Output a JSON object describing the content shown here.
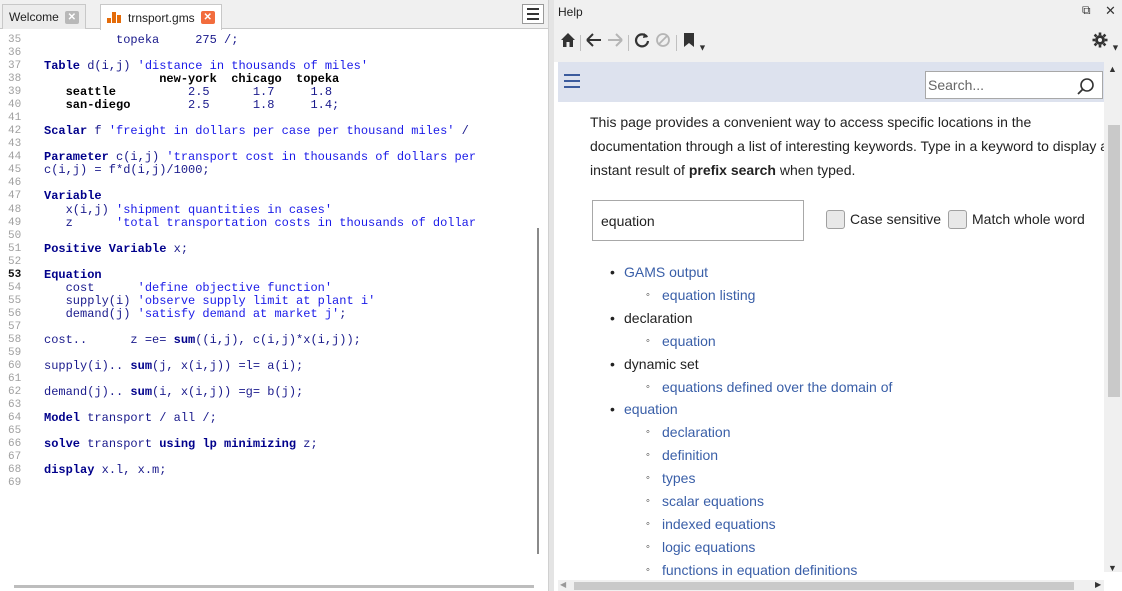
{
  "editor": {
    "tabs": [
      {
        "label": "Welcome",
        "active": false
      },
      {
        "label": "trnsport.gms",
        "active": true
      }
    ],
    "current_line": "53",
    "lines": [
      {
        "n": "35",
        "segs": [
          {
            "t": "nm",
            "v": "          topeka     275 /;"
          }
        ]
      },
      {
        "n": "36",
        "segs": []
      },
      {
        "n": "37",
        "segs": [
          {
            "t": "kw",
            "v": "Table"
          },
          {
            "t": "nm",
            "v": " d(i,j) "
          },
          {
            "t": "st",
            "v": "'distance in thousands of miles'"
          }
        ]
      },
      {
        "n": "38",
        "segs": [
          {
            "t": "bl",
            "v": "                new-york  chicago  topeka"
          }
        ]
      },
      {
        "n": "39",
        "segs": [
          {
            "t": "bl",
            "v": "   seattle"
          },
          {
            "t": "nm",
            "v": "          2.5      1.7     1.8"
          }
        ]
      },
      {
        "n": "40",
        "segs": [
          {
            "t": "bl",
            "v": "   san-diego"
          },
          {
            "t": "nm",
            "v": "        2.5      1.8     1.4;"
          }
        ]
      },
      {
        "n": "41",
        "segs": []
      },
      {
        "n": "42",
        "segs": [
          {
            "t": "kw",
            "v": "Scalar"
          },
          {
            "t": "nm",
            "v": " f "
          },
          {
            "t": "st",
            "v": "'freight in dollars per case per thousand miles'"
          },
          {
            "t": "nm",
            "v": " /"
          }
        ]
      },
      {
        "n": "43",
        "segs": []
      },
      {
        "n": "44",
        "segs": [
          {
            "t": "kw",
            "v": "Parameter"
          },
          {
            "t": "nm",
            "v": " c(i,j) "
          },
          {
            "t": "st",
            "v": "'transport cost in thousands of dollars per"
          }
        ]
      },
      {
        "n": "45",
        "segs": [
          {
            "t": "nm",
            "v": "c(i,j) = f*d(i,j)/1000;"
          }
        ]
      },
      {
        "n": "46",
        "segs": []
      },
      {
        "n": "47",
        "segs": [
          {
            "t": "kw",
            "v": "Variable"
          }
        ]
      },
      {
        "n": "48",
        "segs": [
          {
            "t": "nm",
            "v": "   x(i,j) "
          },
          {
            "t": "st",
            "v": "'shipment quantities in cases'"
          }
        ]
      },
      {
        "n": "49",
        "segs": [
          {
            "t": "nm",
            "v": "   z      "
          },
          {
            "t": "st",
            "v": "'total transportation costs in thousands of dollar"
          }
        ]
      },
      {
        "n": "50",
        "segs": []
      },
      {
        "n": "51",
        "segs": [
          {
            "t": "kw",
            "v": "Positive Variable"
          },
          {
            "t": "nm",
            "v": " x;"
          }
        ]
      },
      {
        "n": "52",
        "segs": []
      },
      {
        "n": "53",
        "segs": [
          {
            "t": "kw",
            "v": "Equation"
          }
        ]
      },
      {
        "n": "54",
        "segs": [
          {
            "t": "nm",
            "v": "   cost      "
          },
          {
            "t": "st",
            "v": "'define objective function'"
          }
        ]
      },
      {
        "n": "55",
        "segs": [
          {
            "t": "nm",
            "v": "   supply(i) "
          },
          {
            "t": "st",
            "v": "'observe supply limit at plant i'"
          }
        ]
      },
      {
        "n": "56",
        "segs": [
          {
            "t": "nm",
            "v": "   demand(j) "
          },
          {
            "t": "st",
            "v": "'satisfy demand at market j'"
          },
          {
            "t": "nm",
            "v": ";"
          }
        ]
      },
      {
        "n": "57",
        "segs": []
      },
      {
        "n": "58",
        "segs": [
          {
            "t": "nm",
            "v": "cost..      z =e= "
          },
          {
            "t": "kw",
            "v": "sum"
          },
          {
            "t": "nm",
            "v": "((i,j), c(i,j)*x(i,j));"
          }
        ]
      },
      {
        "n": "59",
        "segs": []
      },
      {
        "n": "60",
        "segs": [
          {
            "t": "nm",
            "v": "supply(i).. "
          },
          {
            "t": "kw",
            "v": "sum"
          },
          {
            "t": "nm",
            "v": "(j, x(i,j)) =l= a(i);"
          }
        ]
      },
      {
        "n": "61",
        "segs": []
      },
      {
        "n": "62",
        "segs": [
          {
            "t": "nm",
            "v": "demand(j).. "
          },
          {
            "t": "kw",
            "v": "sum"
          },
          {
            "t": "nm",
            "v": "(i, x(i,j)) =g= b(j);"
          }
        ]
      },
      {
        "n": "63",
        "segs": []
      },
      {
        "n": "64",
        "segs": [
          {
            "t": "kw",
            "v": "Model"
          },
          {
            "t": "nm",
            "v": " transport / all /;"
          }
        ]
      },
      {
        "n": "65",
        "segs": []
      },
      {
        "n": "66",
        "segs": [
          {
            "t": "kw",
            "v": "solve"
          },
          {
            "t": "nm",
            "v": " transport "
          },
          {
            "t": "kw",
            "v": "using lp minimizing"
          },
          {
            "t": "nm",
            "v": " z;"
          }
        ]
      },
      {
        "n": "67",
        "segs": []
      },
      {
        "n": "68",
        "segs": [
          {
            "t": "kw",
            "v": "display"
          },
          {
            "t": "nm",
            "v": " x.l, x.m;"
          }
        ]
      },
      {
        "n": "69",
        "segs": []
      }
    ]
  },
  "help": {
    "title": "Help",
    "search_placeholder": "Search...",
    "intro_part1": "This page provides a convenient way to access specific locations in the documentation through a list of interesting keywords. Type in a keyword to display an instant result of ",
    "intro_bold": "prefix search",
    "intro_part2": " when typed.",
    "keyword_value": "equation",
    "case_sensitive_label": "Case sensitive",
    "whole_word_label": "Match whole word",
    "results": [
      {
        "level": 0,
        "label": "GAMS output",
        "link": true
      },
      {
        "level": 1,
        "label": "equation listing",
        "link": true
      },
      {
        "level": 0,
        "label": "declaration",
        "link": false
      },
      {
        "level": 1,
        "label": "equation",
        "link": true
      },
      {
        "level": 0,
        "label": "dynamic set",
        "link": false
      },
      {
        "level": 1,
        "label": "equations defined over the domain of",
        "link": true
      },
      {
        "level": 0,
        "label": "equation",
        "link": true
      },
      {
        "level": 1,
        "label": "declaration",
        "link": true
      },
      {
        "level": 1,
        "label": "definition",
        "link": true
      },
      {
        "level": 1,
        "label": "types",
        "link": true
      },
      {
        "level": 1,
        "label": "scalar equations",
        "link": true
      },
      {
        "level": 1,
        "label": "indexed equations",
        "link": true
      },
      {
        "level": 1,
        "label": "logic equations",
        "link": true
      },
      {
        "level": 1,
        "label": "functions in equation definitions",
        "link": true
      }
    ]
  },
  "colors": {
    "link": "#3a5fa8",
    "keyword": "#00008b",
    "string": "#1a1ae8",
    "tab_close": "#f26c3d"
  },
  "icons": [
    "home-icon",
    "back-arrow-icon",
    "forward-arrow-icon",
    "reload-icon",
    "stop-icon",
    "bookmark-icon",
    "gear-icon",
    "search-icon",
    "menu-icon",
    "float-icon",
    "close-icon"
  ]
}
